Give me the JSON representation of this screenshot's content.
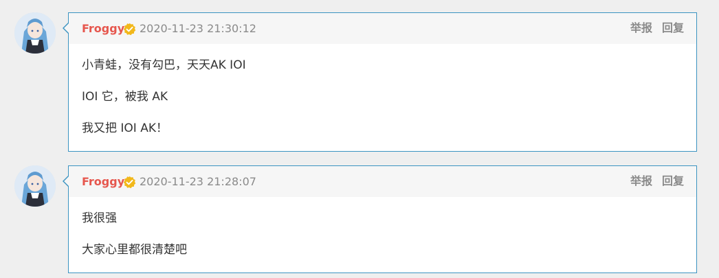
{
  "comments": [
    {
      "user": "Froggy",
      "time": "2020-11-23 21:30:12",
      "report_label": "举报",
      "reply_label": "回复",
      "lines": [
        "小青蛙，没有勾巴，天天AK IOI",
        "IOI 它，被我 AK",
        "我又把 IOI AK！"
      ]
    },
    {
      "user": "Froggy",
      "time": "2020-11-23 21:28:07",
      "report_label": "举报",
      "reply_label": "回复",
      "lines": [
        "我很强",
        "大家心里都很清楚吧"
      ]
    }
  ],
  "colors": {
    "username": "#e6574e",
    "border": "#3a93c1",
    "badge": "#f2b81b",
    "meta": "#8a8a8a",
    "text": "#333333"
  },
  "icons": {
    "badge": "verified-check-badge-icon"
  }
}
